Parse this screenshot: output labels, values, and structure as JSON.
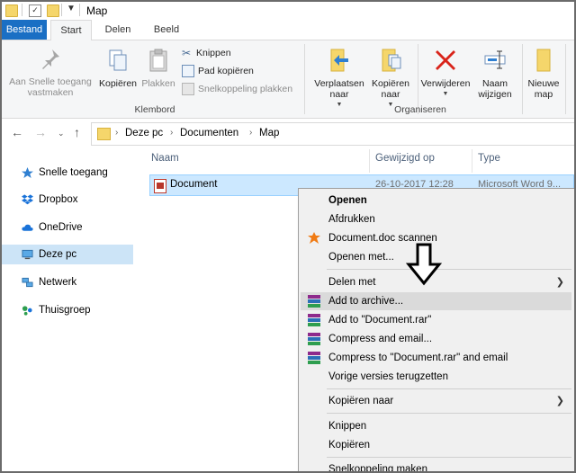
{
  "window": {
    "title": "Map"
  },
  "ribbon": {
    "tabs": {
      "file": "Bestand",
      "start": "Start",
      "share": "Delen",
      "view": "Beeld"
    },
    "clipboard": {
      "pin": "Aan Snelle toegang vastmaken",
      "copy": "Kopiëren",
      "paste": "Plakken",
      "cut": "Knippen",
      "copy_path": "Pad kopiëren",
      "paste_shortcut": "Snelkoppeling plakken",
      "group_label": "Klembord"
    },
    "organize": {
      "move_to": "Verplaatsen naar",
      "copy_to": "Kopiëren naar",
      "delete": "Verwijderen",
      "rename": "Naam wijzigen",
      "group_label": "Organiseren"
    },
    "new": {
      "new_folder": "Nieuwe map"
    }
  },
  "address": {
    "crumbs": [
      "Deze pc",
      "Documenten",
      "Map"
    ]
  },
  "sidebar": {
    "items": [
      {
        "label": "Snelle toegang",
        "icon": "star-icon"
      },
      {
        "label": "Dropbox",
        "icon": "dropbox-icon"
      },
      {
        "label": "OneDrive",
        "icon": "cloud-icon"
      },
      {
        "label": "Deze pc",
        "icon": "computer-icon"
      },
      {
        "label": "Netwerk",
        "icon": "network-icon"
      },
      {
        "label": "Thuisgroep",
        "icon": "homegroup-icon"
      }
    ]
  },
  "filelist": {
    "columns": {
      "name": "Naam",
      "modified": "Gewijzigd op",
      "type": "Type"
    },
    "rows": [
      {
        "name": "Document",
        "modified": "26-10-2017 12:28",
        "type": "Microsoft Word 9..."
      }
    ]
  },
  "context_menu": {
    "open": "Openen",
    "print": "Afdrukken",
    "scan": "Document.doc scannen",
    "open_with": "Openen met...",
    "share_with": "Delen met",
    "add_archive": "Add to archive...",
    "add_rar": "Add to \"Document.rar\"",
    "compress_email": "Compress and email...",
    "compress_rar_email": "Compress to \"Document.rar\" and email",
    "previous_versions": "Vorige versies terugzetten",
    "send_to": "Kopiëren naar",
    "cut": "Knippen",
    "copy": "Kopiëren",
    "create_shortcut": "Snelkoppeling maken"
  },
  "colors": {
    "accent": "#1a6fc4",
    "selection": "#cce8ff",
    "folder": "#f5d66b",
    "delete_red": "#d9241b"
  }
}
